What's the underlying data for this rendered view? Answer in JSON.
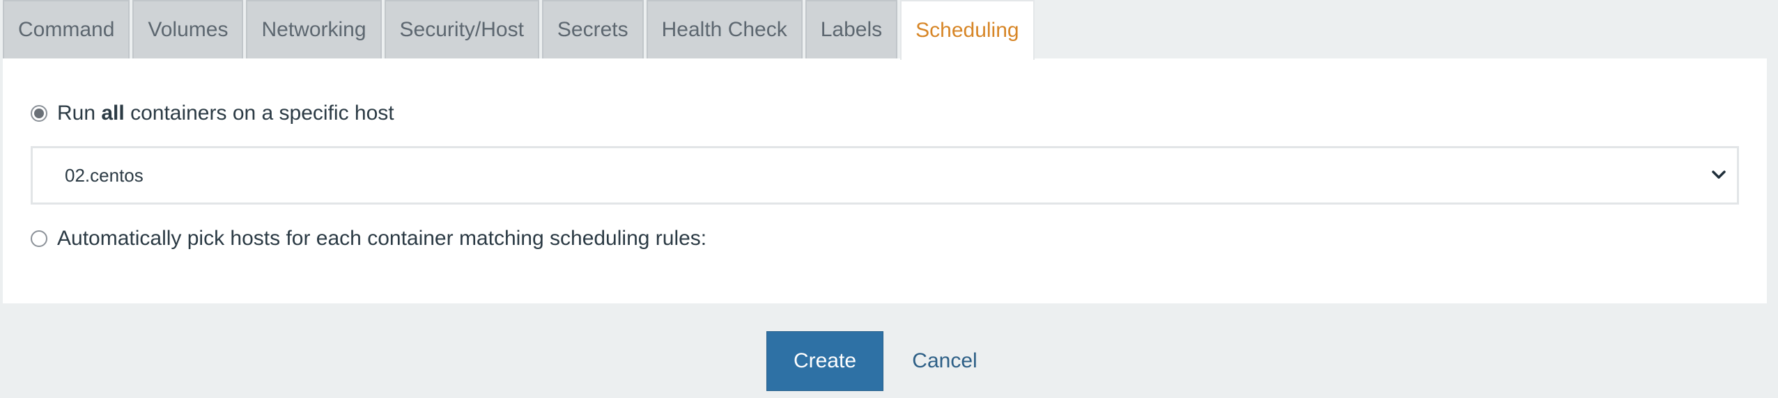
{
  "tabs": [
    {
      "label": "Command",
      "active": false
    },
    {
      "label": "Volumes",
      "active": false
    },
    {
      "label": "Networking",
      "active": false
    },
    {
      "label": "Security/Host",
      "active": false
    },
    {
      "label": "Secrets",
      "active": false
    },
    {
      "label": "Health Check",
      "active": false
    },
    {
      "label": "Labels",
      "active": false
    },
    {
      "label": "Scheduling",
      "active": true
    }
  ],
  "scheduling": {
    "option_specific": {
      "prefix": "Run ",
      "bold": "all",
      "suffix": " containers on a specific host",
      "checked": true
    },
    "host_select": {
      "selected": "02.centos"
    },
    "option_auto": {
      "label": "Automatically pick hosts for each container matching scheduling rules:",
      "checked": false
    }
  },
  "actions": {
    "create_label": "Create",
    "cancel_label": "Cancel"
  },
  "colors": {
    "active_tab_text": "#d78627",
    "primary_button": "#2e71a5",
    "link": "#2d5f86"
  }
}
